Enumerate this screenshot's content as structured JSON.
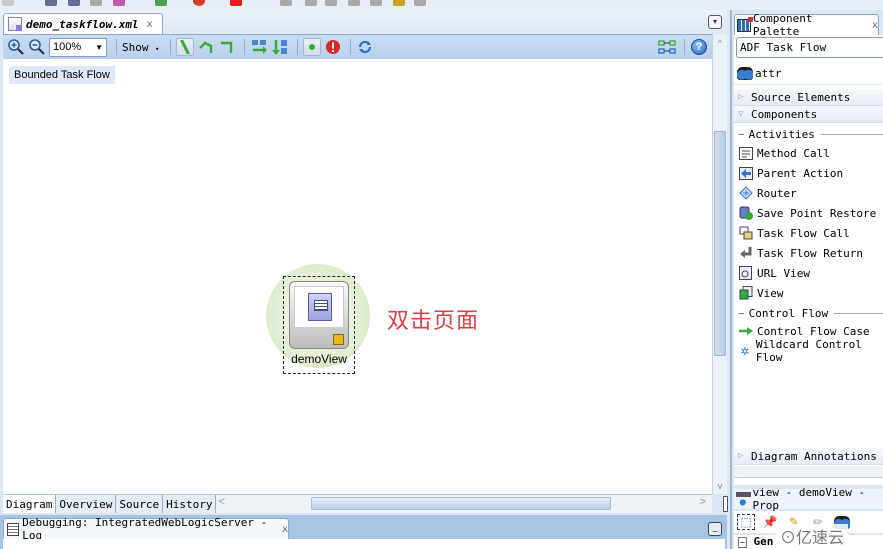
{
  "editor": {
    "tab": {
      "label": "demo_taskflow.xml",
      "close": "x"
    },
    "tab_list_icon": "▾",
    "toolbar": {
      "zoom_in_icon": "zoom-in",
      "zoom_out_icon": "zoom-out",
      "zoom_value": "100%",
      "show_label": "Show",
      "dropdown_arrow": "▼",
      "show_arrow": "▾",
      "help": "?"
    },
    "canvas": {
      "bounded_label": "Bounded Task Flow",
      "node": {
        "label": "demoView",
        "type": "view"
      },
      "annotation": "双击页面",
      "annotation_color": "#d9424a"
    },
    "bottom_tabs": [
      {
        "label": "Diagram",
        "active": true
      },
      {
        "label": "Overview",
        "active": false
      },
      {
        "label": "Source",
        "active": false
      },
      {
        "label": "History",
        "active": false
      }
    ],
    "scroll": {
      "left": "<",
      "right": ">",
      "up": "^",
      "down": "v"
    }
  },
  "log_panel": {
    "tab_label": "Debugging: IntegratedWebLogicServer - Log",
    "close": "x",
    "minimize": "_"
  },
  "palette": {
    "tab_label": "Component Palette",
    "close": "x",
    "category": "ADF Task Flow",
    "search_value": "attr",
    "sections": {
      "source_elements": "Source Elements",
      "components": "Components",
      "diagram_annotations": "Diagram Annotations"
    },
    "groups": {
      "activities": "Activities",
      "control_flow": "Control Flow"
    },
    "activities": [
      {
        "label": "Method Call",
        "icon": "method-call"
      },
      {
        "label": "Parent Action",
        "icon": "parent-action"
      },
      {
        "label": "Router",
        "icon": "router"
      },
      {
        "label": "Save Point Restore",
        "icon": "save-point-restore"
      },
      {
        "label": "Task Flow Call",
        "icon": "task-flow-call"
      },
      {
        "label": "Task Flow Return",
        "icon": "task-flow-return"
      },
      {
        "label": "URL View",
        "icon": "url-view"
      },
      {
        "label": "View",
        "icon": "view"
      }
    ],
    "control_flow": [
      {
        "label": "Control Flow Case",
        "icon": "control-flow-case"
      },
      {
        "label": "Wildcard Control Flow",
        "icon": "wildcard-control-flow"
      }
    ]
  },
  "property_panel": {
    "tab_label": "view - demoView - Prop",
    "section_label": "Gen"
  },
  "watermark": "⊙亿速云",
  "colors": {
    "accent_blue": "#b9d1ec",
    "annotation_red": "#d9424a",
    "node_glow": "#cfe4b4"
  }
}
